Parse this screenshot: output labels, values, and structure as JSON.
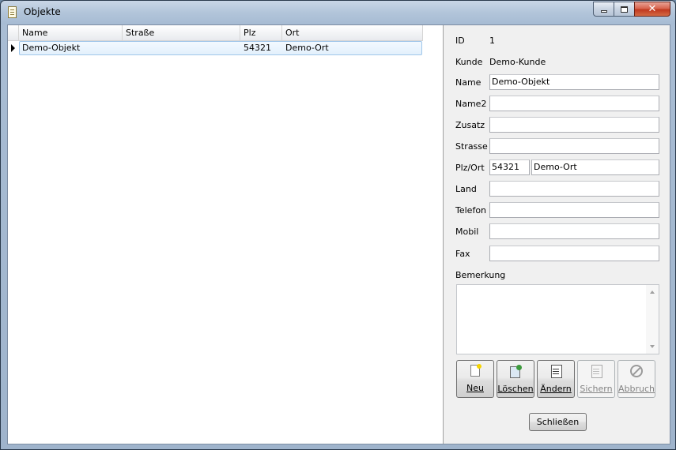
{
  "window": {
    "title": "Objekte"
  },
  "grid": {
    "columns": [
      "Name",
      "Straße",
      "Plz",
      "Ort"
    ],
    "rows": [
      {
        "name": "Demo-Objekt",
        "strasse": "",
        "plz": "54321",
        "ort": "Demo-Ort"
      }
    ]
  },
  "details": {
    "id_label": "ID",
    "id_value": "1",
    "kunde_label": "Kunde",
    "kunde_value": "Demo-Kunde",
    "name_label": "Name",
    "name_value": "Demo-Objekt",
    "name2_label": "Name2",
    "name2_value": "",
    "zusatz_label": "Zusatz",
    "zusatz_value": "",
    "strasse_label": "Strasse",
    "strasse_value": "",
    "plzort_label": "Plz/Ort",
    "plz_value": "54321",
    "ort_value": "Demo-Ort",
    "land_label": "Land",
    "land_value": "",
    "telefon_label": "Telefon",
    "telefon_value": "",
    "mobil_label": "Mobil",
    "mobil_value": "",
    "fax_label": "Fax",
    "fax_value": "",
    "bemerkung_label": "Bemerkung",
    "bemerkung_value": ""
  },
  "actions": {
    "neu": "Neu",
    "loeschen": "Löschen",
    "aendern": "Ändern",
    "sichern": "Sichern",
    "abbruch": "Abbruch",
    "schliessen": "Schließen"
  },
  "icons": {
    "window": "document-list-icon",
    "new": "new-document-icon",
    "delete": "delete-document-icon",
    "edit": "edit-document-icon",
    "save": "save-document-icon",
    "cancel": "cancel-icon"
  }
}
